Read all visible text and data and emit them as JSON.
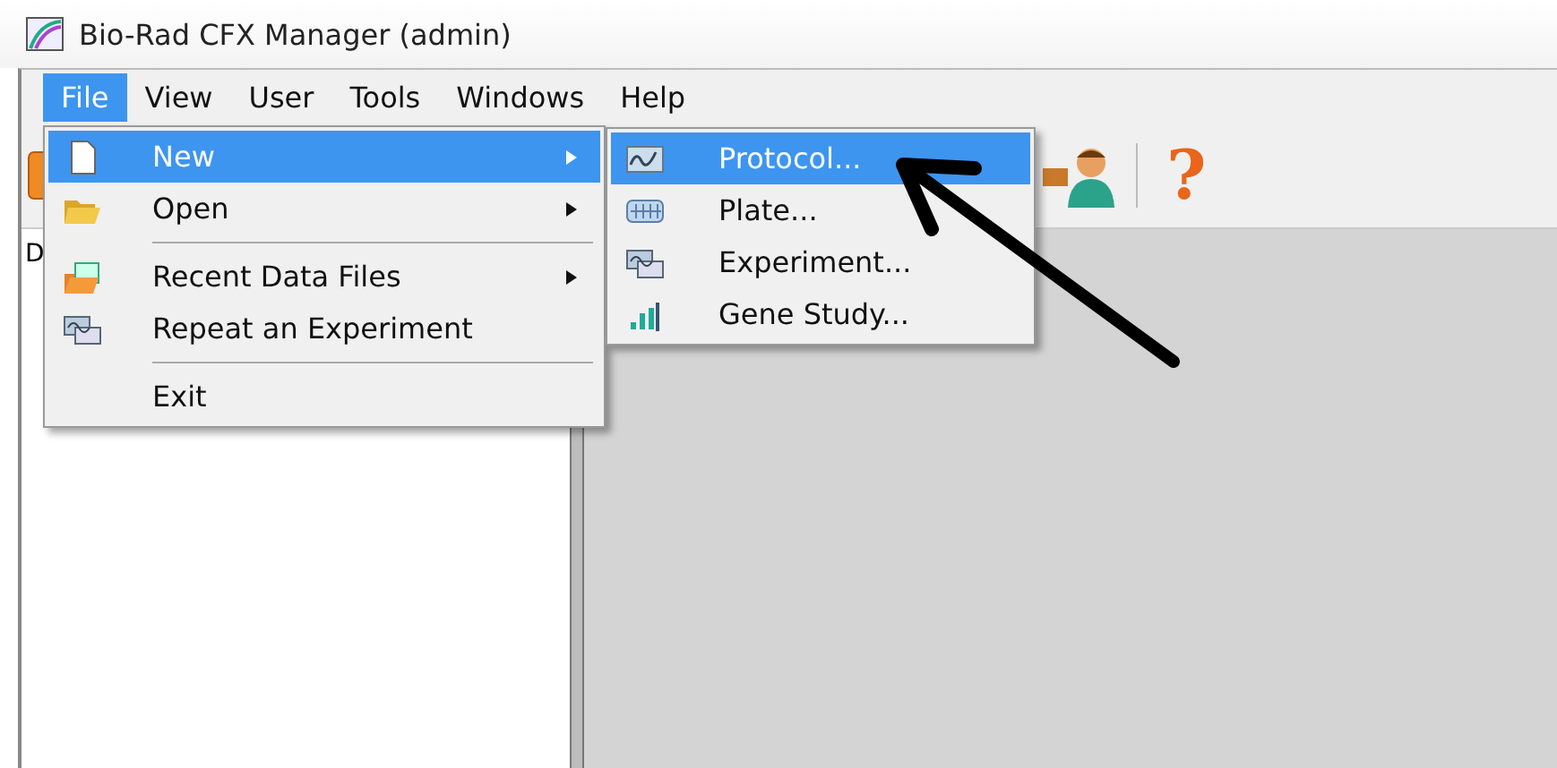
{
  "window": {
    "title": "Bio-Rad CFX Manager (admin)"
  },
  "menubar": [
    {
      "label": "File",
      "selected": true
    },
    {
      "label": "View",
      "selected": false
    },
    {
      "label": "User",
      "selected": false
    },
    {
      "label": "Tools",
      "selected": false
    },
    {
      "label": "Windows",
      "selected": false
    },
    {
      "label": "Help",
      "selected": false
    }
  ],
  "toolbar": {
    "help_glyph": "?"
  },
  "left_panel": {
    "label": "D"
  },
  "file_menu": [
    {
      "kind": "item",
      "label": "New",
      "submenu": true,
      "selected": true
    },
    {
      "kind": "item",
      "label": "Open",
      "submenu": true,
      "selected": false
    },
    {
      "kind": "separator"
    },
    {
      "kind": "item",
      "label": "Recent Data Files",
      "submenu": true,
      "selected": false
    },
    {
      "kind": "item",
      "label": "Repeat an Experiment",
      "submenu": false,
      "selected": false
    },
    {
      "kind": "separator"
    },
    {
      "kind": "item",
      "label": "Exit",
      "submenu": false,
      "selected": false
    }
  ],
  "new_submenu": [
    {
      "label": "Protocol...",
      "selected": true
    },
    {
      "label": "Plate...",
      "selected": false
    },
    {
      "label": "Experiment...",
      "selected": false
    },
    {
      "label": "Gene Study...",
      "selected": false
    }
  ]
}
